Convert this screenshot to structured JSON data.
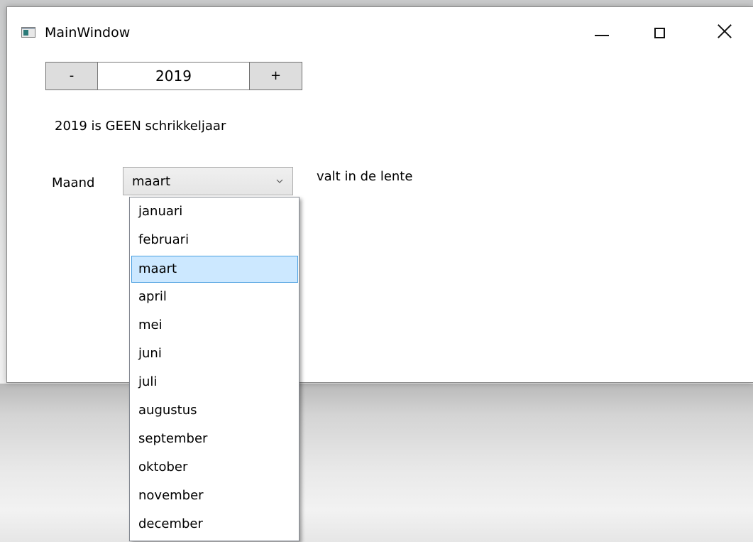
{
  "window": {
    "title": "MainWindow",
    "minimize_icon": "minimize-icon",
    "maximize_icon": "maximize-icon",
    "close_icon": "close-icon"
  },
  "year_control": {
    "minus_label": "-",
    "year_value": "2019",
    "plus_label": "+"
  },
  "leap_status": "2019 is GEEN schrikkeljaar",
  "month_control": {
    "label": "Maand",
    "selected": "maart",
    "season_text": "valt in de lente",
    "options": [
      "januari",
      "februari",
      "maart",
      "april",
      "mei",
      "juni",
      "juli",
      "augustus",
      "september",
      "oktober",
      "november",
      "december"
    ],
    "selected_index": 2,
    "highlight_color": "#cce8ff",
    "highlight_border": "#4a9fe0"
  }
}
